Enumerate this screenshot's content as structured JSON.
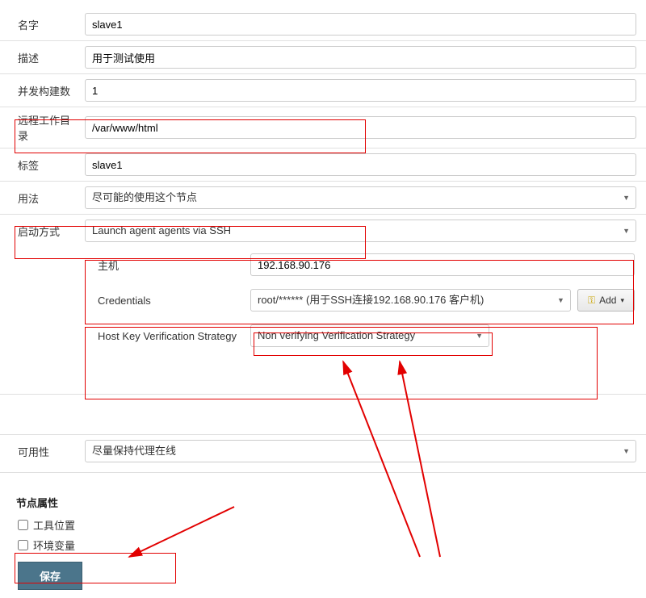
{
  "labels": {
    "name": "名字",
    "desc": "描述",
    "executors": "并发构建数",
    "remoteRoot": "远程工作目录",
    "tags": "标签",
    "usage": "用法",
    "launchMethod": "启动方式",
    "availability": "可用性",
    "host": "主机",
    "credentials": "Credentials",
    "hostKeyStrategy": "Host Key Verification Strategy"
  },
  "values": {
    "name": "slave1",
    "desc": "用于测试使用",
    "executors": "1",
    "remoteRoot": "/var/www/html",
    "tags": "slave1",
    "usage": "尽可能的使用这个节点",
    "launchMethod": "Launch agent agents via SSH",
    "host": "192.168.90.176",
    "credentials": "root/****** (用于SSH连接192.168.90.176 客户机)",
    "hostKeyStrategy": "Non verifying Verification Strategy",
    "availability": "尽量保持代理在线"
  },
  "nodeProps": {
    "heading": "节点属性",
    "toolLocations": "工具位置",
    "envVars": "环境变量"
  },
  "buttons": {
    "add": "Add",
    "save": "保存"
  }
}
